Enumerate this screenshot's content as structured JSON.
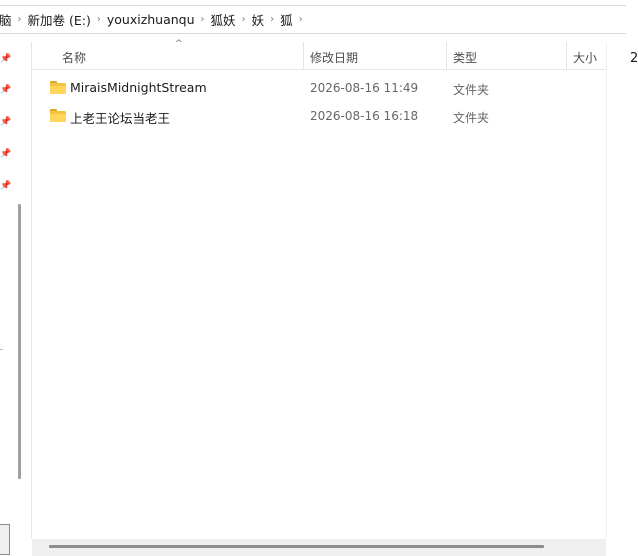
{
  "breadcrumb": [
    "脑",
    "新加卷 (E:)",
    "youxizhuanqu",
    "狐妖",
    "妖",
    "狐"
  ],
  "edge_text": "2",
  "columns": {
    "name": "名称",
    "modified": "修改日期",
    "type": "类型",
    "size": "大小"
  },
  "rows": [
    {
      "name": "MiraisMidnightStream",
      "modified": "2026-08-16 11:49",
      "type": "文件夹"
    },
    {
      "name": "上老王论坛当老王",
      "modified": "2026-08-16 16:18",
      "type": "文件夹"
    }
  ],
  "icons": {
    "pin": "pin-icon",
    "folder": "folder-icon",
    "chevron": "chevron-right-icon",
    "sort": "sort-up-icon"
  }
}
